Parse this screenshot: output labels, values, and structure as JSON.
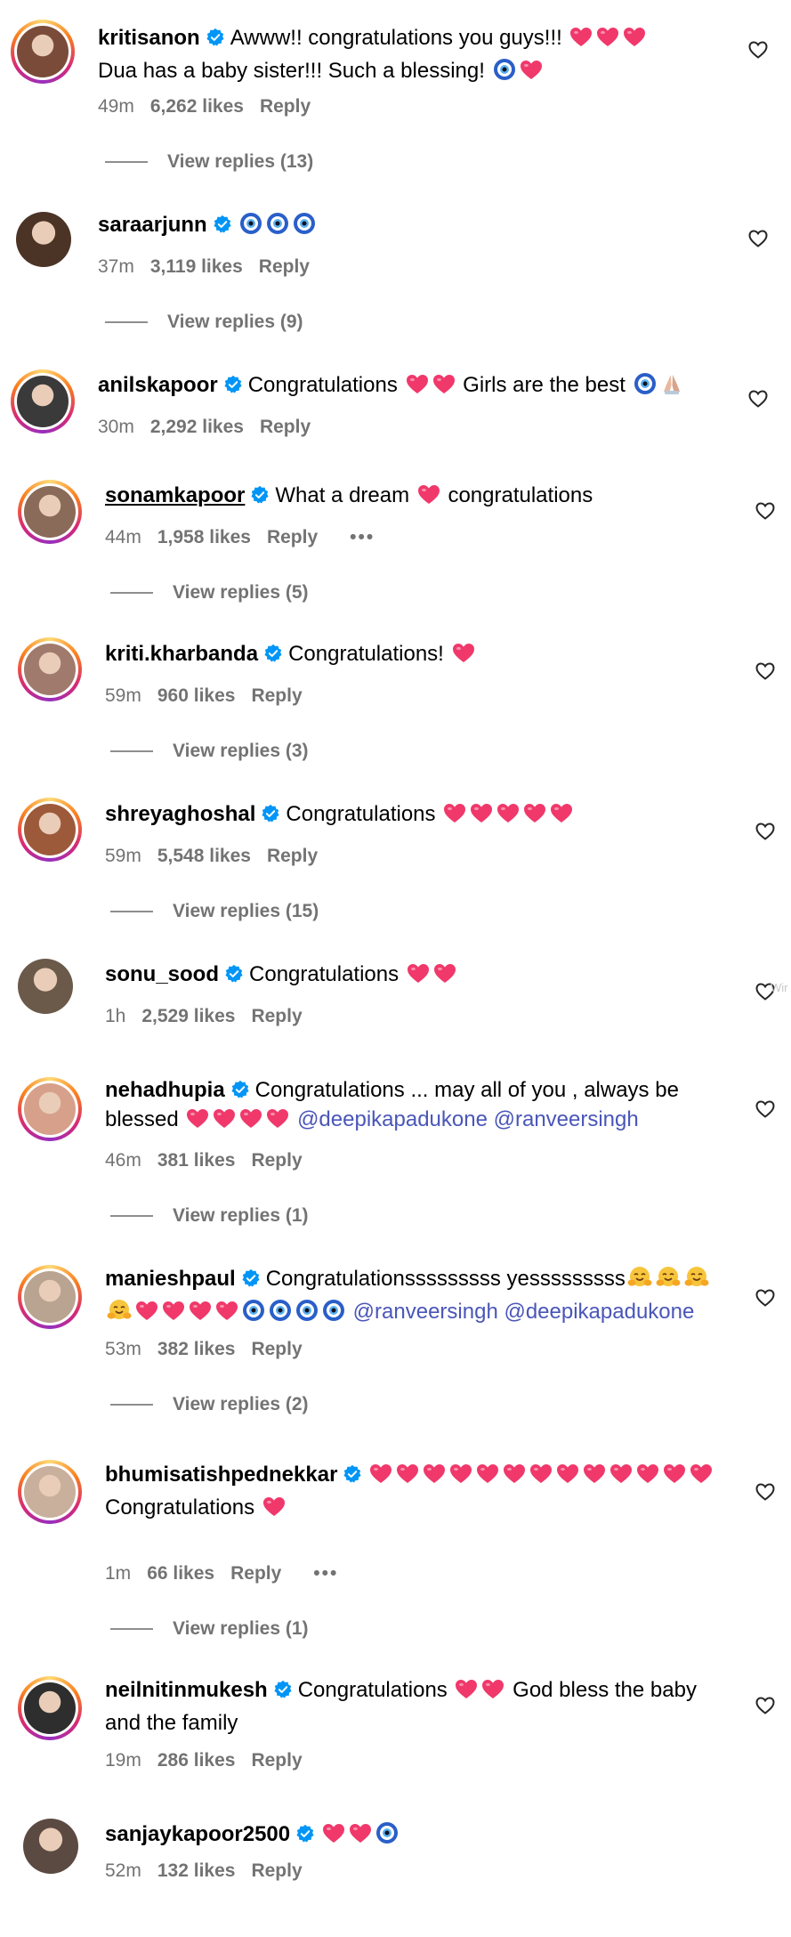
{
  "comments": [
    {
      "username": "kritisanon",
      "verified": true,
      "segments": [
        {
          "t": "text",
          "v": "Awww!! congratulations you guys!!! "
        },
        {
          "t": "emoji",
          "v": "heart"
        },
        {
          "t": "emoji",
          "v": "heart"
        },
        {
          "t": "emoji",
          "v": "heart"
        },
        {
          "t": "br"
        },
        {
          "t": "text",
          "v": "Dua has a baby sister!!! Such a blessing! "
        },
        {
          "t": "emoji",
          "v": "nazar"
        },
        {
          "t": "emoji",
          "v": "heart"
        }
      ],
      "time": "49m",
      "likes": "6,262 likes",
      "reply": "Reply",
      "view_replies": "View replies (13)"
    },
    {
      "username": "saraarjunn",
      "verified": true,
      "segments": [
        {
          "t": "emoji",
          "v": "nazar"
        },
        {
          "t": "emoji",
          "v": "nazar"
        },
        {
          "t": "emoji",
          "v": "nazar"
        }
      ],
      "time": "37m",
      "likes": "3,119 likes",
      "reply": "Reply",
      "view_replies": "View replies (9)"
    },
    {
      "username": "anilskapoor",
      "verified": true,
      "segments": [
        {
          "t": "text",
          "v": "Congratulations "
        },
        {
          "t": "emoji",
          "v": "heart"
        },
        {
          "t": "emoji",
          "v": "heart"
        },
        {
          "t": "text",
          "v": " Girls are the best "
        },
        {
          "t": "emoji",
          "v": "nazar"
        },
        {
          "t": "emoji",
          "v": "pray"
        }
      ],
      "time": "30m",
      "likes": "2,292 likes",
      "reply": "Reply"
    },
    {
      "username": "sonamkapoor",
      "verified": true,
      "underline": true,
      "segments": [
        {
          "t": "text",
          "v": "What a dream "
        },
        {
          "t": "emoji",
          "v": "heart"
        },
        {
          "t": "text",
          "v": " congratulations"
        }
      ],
      "time": "44m",
      "likes": "1,958 likes",
      "reply": "Reply",
      "more": "•••",
      "view_replies": "View replies (5)"
    },
    {
      "username": "kriti.kharbanda",
      "verified": true,
      "segments": [
        {
          "t": "text",
          "v": "Congratulations! "
        },
        {
          "t": "emoji",
          "v": "heart"
        }
      ],
      "time": "59m",
      "likes": "960 likes",
      "reply": "Reply",
      "view_replies": "View replies (3)"
    },
    {
      "username": "shreyaghoshal",
      "verified": true,
      "segments": [
        {
          "t": "text",
          "v": "Congratulations "
        },
        {
          "t": "emoji",
          "v": "heart"
        },
        {
          "t": "emoji",
          "v": "heart"
        },
        {
          "t": "emoji",
          "v": "heart"
        },
        {
          "t": "emoji",
          "v": "heart"
        },
        {
          "t": "emoji",
          "v": "heart"
        }
      ],
      "time": "59m",
      "likes": "5,548 likes",
      "reply": "Reply",
      "view_replies": "View replies (15)"
    },
    {
      "username": "sonu_sood",
      "verified": true,
      "segments": [
        {
          "t": "text",
          "v": "Congratulations "
        },
        {
          "t": "emoji",
          "v": "heart"
        },
        {
          "t": "emoji",
          "v": "heart"
        }
      ],
      "time": "1h",
      "likes": "2,529 likes",
      "reply": "Reply"
    },
    {
      "username": "nehadhupia",
      "verified": true,
      "segments": [
        {
          "t": "text",
          "v": "Congratulations ... may all of you , always be blessed "
        },
        {
          "t": "emoji",
          "v": "heart"
        },
        {
          "t": "emoji",
          "v": "heart"
        },
        {
          "t": "emoji",
          "v": "heart"
        },
        {
          "t": "emoji",
          "v": "heart"
        },
        {
          "t": "text",
          "v": " "
        },
        {
          "t": "mention",
          "v": "@deepikapadukone"
        },
        {
          "t": "text",
          "v": " "
        },
        {
          "t": "mention",
          "v": "@ranveersingh"
        }
      ],
      "time": "46m",
      "likes": "381 likes",
      "reply": "Reply",
      "view_replies": "View replies (1)"
    },
    {
      "username": "manieshpaul",
      "verified": true,
      "segments": [
        {
          "t": "text",
          "v": "Congratulationsssssssss yesssssssss"
        },
        {
          "t": "emoji",
          "v": "hug"
        },
        {
          "t": "emoji",
          "v": "hug"
        },
        {
          "t": "emoji",
          "v": "hug"
        },
        {
          "t": "emoji",
          "v": "hug"
        },
        {
          "t": "emoji",
          "v": "heart"
        },
        {
          "t": "emoji",
          "v": "heart"
        },
        {
          "t": "emoji",
          "v": "heart"
        },
        {
          "t": "emoji",
          "v": "heart"
        },
        {
          "t": "emoji",
          "v": "nazar"
        },
        {
          "t": "emoji",
          "v": "nazar"
        },
        {
          "t": "emoji",
          "v": "nazar"
        },
        {
          "t": "emoji",
          "v": "nazar"
        },
        {
          "t": "text",
          "v": " "
        },
        {
          "t": "mention",
          "v": "@ranveersingh"
        },
        {
          "t": "text",
          "v": " "
        },
        {
          "t": "mention",
          "v": "@deepikapadukone"
        }
      ],
      "time": "53m",
      "likes": "382 likes",
      "reply": "Reply",
      "view_replies": "View replies (2)"
    },
    {
      "username": "bhumisatishpednekkar",
      "verified": true,
      "segments": [
        {
          "t": "emoji",
          "v": "heart"
        },
        {
          "t": "emoji",
          "v": "heart"
        },
        {
          "t": "emoji",
          "v": "heart"
        },
        {
          "t": "emoji",
          "v": "heart"
        },
        {
          "t": "emoji",
          "v": "heart"
        },
        {
          "t": "emoji",
          "v": "heart"
        },
        {
          "t": "emoji",
          "v": "heart"
        },
        {
          "t": "emoji",
          "v": "heart"
        },
        {
          "t": "emoji",
          "v": "heart"
        },
        {
          "t": "emoji",
          "v": "heart"
        },
        {
          "t": "emoji",
          "v": "heart"
        },
        {
          "t": "emoji",
          "v": "heart"
        },
        {
          "t": "emoji",
          "v": "heart"
        },
        {
          "t": "br"
        },
        {
          "t": "text",
          "v": "Congratulations "
        },
        {
          "t": "emoji",
          "v": "heart"
        }
      ],
      "time": "1m",
      "likes": "66 likes",
      "reply": "Reply",
      "more": "•••",
      "view_replies": "View replies (1)"
    },
    {
      "username": "neilnitinmukesh",
      "verified": true,
      "segments": [
        {
          "t": "text",
          "v": "Congratulations "
        },
        {
          "t": "emoji",
          "v": "heart"
        },
        {
          "t": "emoji",
          "v": "heart"
        },
        {
          "t": "text",
          "v": " God bless the baby and the family"
        }
      ],
      "time": "19m",
      "likes": "286 likes",
      "reply": "Reply"
    },
    {
      "username": "sanjaykapoor2500",
      "verified": true,
      "segments": [
        {
          "t": "emoji",
          "v": "heart"
        },
        {
          "t": "emoji",
          "v": "heart"
        },
        {
          "t": "emoji",
          "v": "nazar"
        }
      ],
      "time": "52m",
      "likes": "132 likes",
      "reply": "Reply"
    }
  ],
  "colors": {
    "verified": "#0095f6",
    "heart_emoji": "#f0386b",
    "mention": "#4a56b8",
    "meta": "#737373"
  },
  "watermark": "Wir"
}
